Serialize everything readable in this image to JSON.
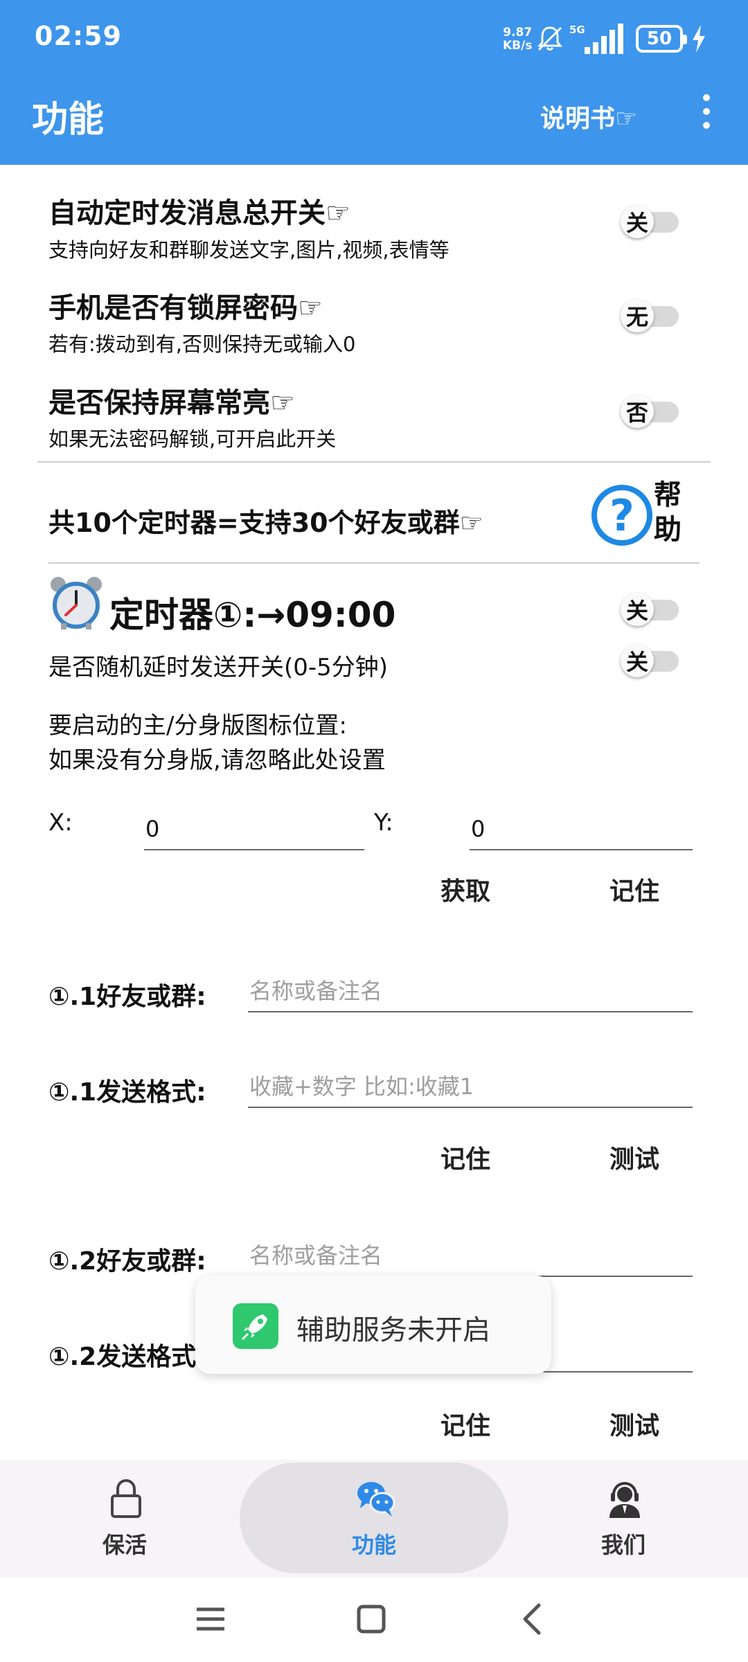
{
  "status_bar": {
    "time": "02:59",
    "net_speed_value": "9.87",
    "net_speed_unit": "KB/s",
    "network_type": "5G",
    "battery": "50"
  },
  "app_bar": {
    "title": "功能",
    "manual_label": "说明书☞"
  },
  "settings": [
    {
      "title": "自动定时发消息总开关☞",
      "subtitle": "支持向好友和群聊发送文字,图片,视频,表情等",
      "switch_label": "关"
    },
    {
      "title": "手机是否有锁屏密码☞",
      "subtitle": "若有:拨动到有,否则保持无或输入0",
      "switch_label": "无"
    },
    {
      "title": "是否保持屏幕常亮☞",
      "subtitle": "如果无法密码解锁,可开启此开关",
      "switch_label": "否"
    }
  ],
  "timer_info": {
    "count_text": "共10个定时器=支持30个好友或群☞",
    "help_label": "帮助"
  },
  "timer1": {
    "title": "定时器①:→09:00",
    "switch_label": "关",
    "random_delay_text": "是否随机延时发送开关(0-5分钟)",
    "random_delay_switch": "关",
    "icon_position_line1": "要启动的主/分身版图标位置:",
    "icon_position_line2": "如果没有分身版,请忽略此处设置",
    "x_label": "X:",
    "x_value": "0",
    "y_label": "Y:",
    "y_value": "0",
    "get_button": "获取",
    "remember_button": "记住",
    "entries": [
      {
        "friend_label": "①.1好友或群:",
        "friend_placeholder": "名称或备注名",
        "format_label": "①.1发送格式:",
        "format_placeholder": "收藏+数字 比如:收藏1",
        "remember": "记住",
        "test": "测试"
      },
      {
        "friend_label": "①.2好友或群:",
        "friend_placeholder": "名称或备注名",
        "format_label": "①.2发送格式:",
        "format_placeholder": "",
        "remember": "记住",
        "test": "测试"
      }
    ]
  },
  "toast": {
    "text": "辅助服务未开启"
  },
  "bottom_nav": [
    {
      "label": "保活",
      "icon": "lock-icon",
      "active": false
    },
    {
      "label": "功能",
      "icon": "chat-icon",
      "active": true
    },
    {
      "label": "我们",
      "icon": "support-agent-icon",
      "active": false
    }
  ],
  "colors": {
    "app_bar": "#3d95ec",
    "accent": "#2e8ae6",
    "help_icon": "#1e88e5",
    "toast_icon": "#2fc86e"
  }
}
